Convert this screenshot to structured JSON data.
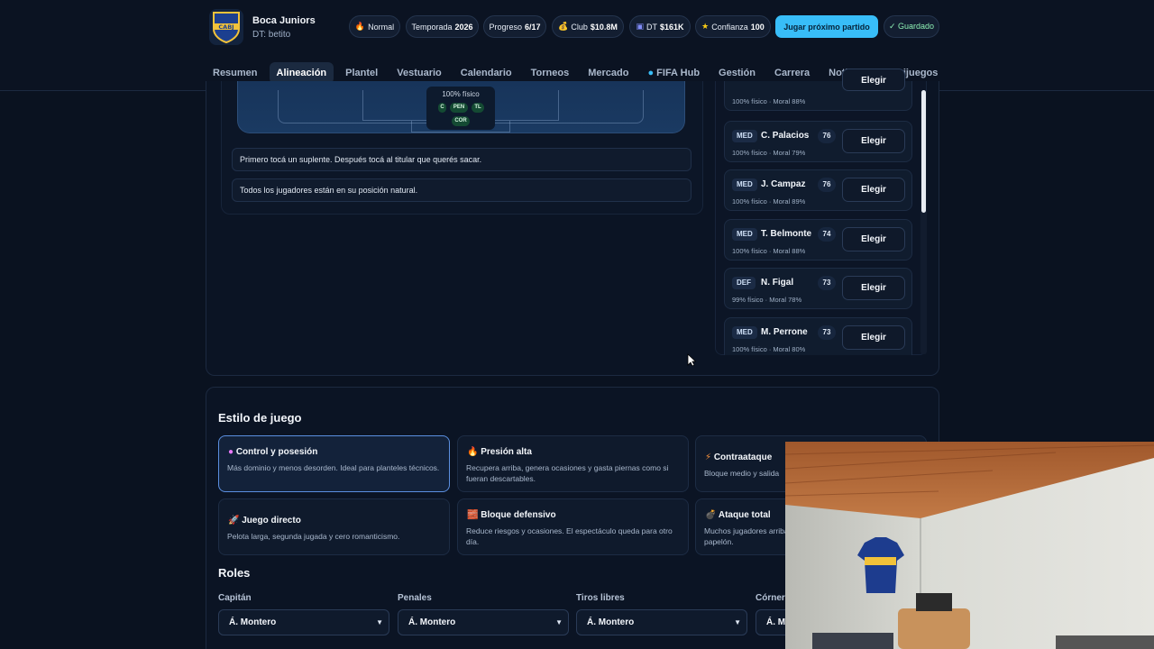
{
  "header": {
    "club_name": "Boca Juniors",
    "coach": "DT: betito",
    "logo_text": "CABJ",
    "pills": {
      "difficulty": "Normal",
      "season_label": "Temporada",
      "season_value": "2026",
      "progress_label": "Progreso",
      "progress_value": "6/17",
      "club_label": "Club",
      "club_value": "$10.8M",
      "dt_label": "DT",
      "dt_value": "$161K",
      "confidence_label": "Confianza",
      "confidence_value": "100",
      "play_next": "Jugar próximo partido",
      "saved": "✓ Guardado"
    }
  },
  "nav": {
    "items": [
      "Resumen",
      "Alineación",
      "Plantel",
      "Vestuario",
      "Calendario",
      "Torneos",
      "Mercado",
      "FIFA Hub",
      "Gestión",
      "Carrera",
      "Noticias",
      "Minijuegos"
    ],
    "active": "Alineación"
  },
  "lineup": {
    "player_card": {
      "fitness": "100% físico",
      "badges": [
        "C",
        "PEN",
        "TL",
        "COR"
      ]
    },
    "hints": [
      "Primero tocá un suplente. Después tocá al titular que querés sacar.",
      "Todos los jugadores están en su posición natural."
    ]
  },
  "bench": {
    "choose_label": "Elegir",
    "partial_top": {
      "meta": "100% físico · Moral 88%"
    },
    "players": [
      {
        "pos": "MED",
        "name": "C. Palacios",
        "rating": "76",
        "meta": "100% físico · Moral 79%"
      },
      {
        "pos": "MED",
        "name": "J. Campaz",
        "rating": "76",
        "meta": "100% físico · Moral 89%"
      },
      {
        "pos": "MED",
        "name": "T. Belmonte",
        "rating": "74",
        "meta": "100% físico · Moral 88%"
      },
      {
        "pos": "DEF",
        "name": "N. Figal",
        "rating": "73",
        "meta": "99% físico · Moral 78%"
      },
      {
        "pos": "MED",
        "name": "M. Perrone",
        "rating": "73",
        "meta": "100% físico · Moral 80%"
      }
    ]
  },
  "play_style": {
    "title": "Estilo de juego",
    "options": [
      {
        "icon": "●",
        "title": "Control y posesión",
        "desc": "Más dominio y menos desorden. Ideal para planteles técnicos.",
        "selected": true
      },
      {
        "icon": "🔥",
        "title": "Presión alta",
        "desc": "Recupera arriba, genera ocasiones y gasta piernas como si fueran descartables.",
        "selected": false
      },
      {
        "icon": "⚡",
        "title": "Contraataque",
        "desc": "Bloque medio y salida",
        "selected": false
      },
      {
        "icon": "🚀",
        "title": "Juego directo",
        "desc": "Pelota larga, segunda jugada y cero romanticismo.",
        "selected": false
      },
      {
        "icon": "🧱",
        "title": "Bloque defensivo",
        "desc": "Reduce riesgos y ocasiones. El espectáculo queda para otro día.",
        "selected": false
      },
      {
        "icon": "💣",
        "title": "Ataque total",
        "desc": "Muchos jugadores arriba papelón.",
        "selected": false
      }
    ]
  },
  "roles": {
    "title": "Roles",
    "fields": [
      {
        "label": "Capitán",
        "value": "Á. Montero"
      },
      {
        "label": "Penales",
        "value": "Á. Montero"
      },
      {
        "label": "Tiros libres",
        "value": "Á. Montero"
      },
      {
        "label": "Córner",
        "value": "Á. M"
      }
    ]
  },
  "colors": {
    "accent": "#38bdf8",
    "background": "#0a1220",
    "selected_border": "#5b8fe0",
    "saved_green": "#8df0b4"
  }
}
